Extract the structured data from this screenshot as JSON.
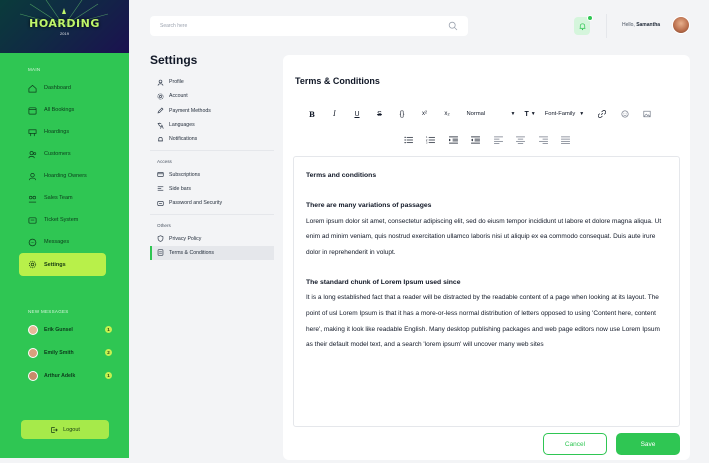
{
  "brand": {
    "title": "HOARDING",
    "subtitle": "2019"
  },
  "sidebar": {
    "menu_heading": "MAIN",
    "items": [
      {
        "label": "Dashboard",
        "icon": "home-icon"
      },
      {
        "label": "All Bookings",
        "icon": "calendar-icon"
      },
      {
        "label": "Hoardings",
        "icon": "billboard-icon"
      },
      {
        "label": "Customers",
        "icon": "users-icon"
      },
      {
        "label": "Hoarding Owners",
        "icon": "user-icon"
      },
      {
        "label": "Sales Team",
        "icon": "team-icon"
      },
      {
        "label": "Ticket System",
        "icon": "ticket-icon"
      },
      {
        "label": "Messages",
        "icon": "chat-icon"
      },
      {
        "label": "Settings",
        "icon": "gear-icon",
        "active": true
      }
    ],
    "messages_heading": "NEW MESSAGES",
    "messages": [
      {
        "name": "Erik Gunsel",
        "count": "1"
      },
      {
        "name": "Emily Smith",
        "count": "2"
      },
      {
        "name": "Arthur Adelk",
        "count": "1"
      }
    ],
    "logout_label": "Logout"
  },
  "header": {
    "search_placeholder": "Search here",
    "greeting": "Hello,",
    "user_name": "Samantha"
  },
  "settings": {
    "title": "Settings",
    "groups": [
      {
        "heading": "",
        "items": [
          {
            "label": "Profile",
            "icon": "user-icon"
          },
          {
            "label": "Account",
            "icon": "gear-icon"
          },
          {
            "label": "Payment Methods",
            "icon": "pen-icon"
          },
          {
            "label": "Languages",
            "icon": "translate-icon"
          },
          {
            "label": "Notifications",
            "icon": "bell-icon"
          }
        ]
      },
      {
        "heading": "Access",
        "items": [
          {
            "label": "Subscriptions",
            "icon": "card-icon"
          },
          {
            "label": "Side bars",
            "icon": "sidebar-icon"
          },
          {
            "label": "Password and Security",
            "icon": "lock-icon"
          }
        ]
      },
      {
        "heading": "Others",
        "items": [
          {
            "label": "Privacy Policy",
            "icon": "shield-icon"
          },
          {
            "label": "Terms & Conditions",
            "icon": "document-icon",
            "active": true
          }
        ]
      }
    ]
  },
  "content": {
    "title": "Terms & Conditions",
    "toolbar": {
      "bold": "B",
      "italic": "I",
      "underline": "U",
      "strike": "S",
      "code": "{}",
      "superscript": "x²",
      "subscript": "x₂",
      "heading_select": "Normal",
      "font_size_select": "T",
      "font_family_select": "Font-Family"
    },
    "editor": {
      "heading": "Terms and conditions",
      "sections": [
        {
          "title": "There are many variations of passages",
          "body": "Lorem ipsum dolor sit amet, consectetur adipiscing elit, sed do eiusm tempor incididunt ut labore et dolore magna aliqua. Ut enim ad minim veniam, quis nostrud exercitation ullamco laboris nisi ut aliquip ex ea commodo consequat. Duis aute irure dolor in reprehenderit in volupt."
        },
        {
          "title": "The standard chunk of Lorem Ipsum used since",
          "body": "It is a long established fact that a reader will be distracted by the readable content of a page when looking at its layout. The point of usl Lorem Ipsum is that it has a more-or-less normal distribution of letters opposed to using 'Content here, content here', making it look like readable English. Many desktop publishing packages and web page editors now use Lorem Ipsum as their default model text, and a search 'lorem ipsum' will uncover many web sites"
        }
      ]
    },
    "cancel_label": "Cancel",
    "save_label": "Save"
  },
  "colors": {
    "primary": "#2fc653",
    "accent": "#b8f04a",
    "surface": "#ffffff",
    "background": "#f3f4f6"
  }
}
